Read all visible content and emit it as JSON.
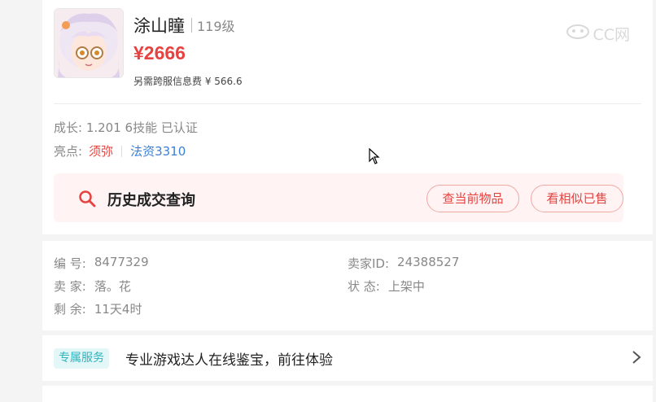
{
  "listing": {
    "name": "涂山瞳",
    "level": "119级",
    "price": "¥2666",
    "fee": "另需跨服信息费 ¥ 566.6",
    "watermark": "CC网",
    "stats": "成长: 1.201 6技能 已认证",
    "highlights_label": "亮点:",
    "highlight_1": "须弥",
    "highlight_2": "法资3310"
  },
  "history": {
    "title": "历史成交查询",
    "current_button": "查当前物品",
    "similar_button": "看相似已售"
  },
  "details": {
    "id_label": "编 号:",
    "id_value": "8477329",
    "seller_id_label": "卖家ID:",
    "seller_id_value": "24388527",
    "seller_label": "卖 家:",
    "seller_value": "落。花",
    "status_label": "状 态:",
    "status_value": "上架中",
    "remaining_label": "剩 余:",
    "remaining_value": "11天4时"
  },
  "service": {
    "badge": "专属服务",
    "text": "专业游戏达人在线鉴宝，前往体验"
  },
  "colors": {
    "price_red": "#e64340",
    "link_blue": "#3d7fd6",
    "badge_teal": "#30b4bd",
    "history_bg": "#fff3f3"
  },
  "icons": [
    "search-icon",
    "chevron-right-icon",
    "watermark-logo-icon",
    "mouse-cursor-icon"
  ]
}
